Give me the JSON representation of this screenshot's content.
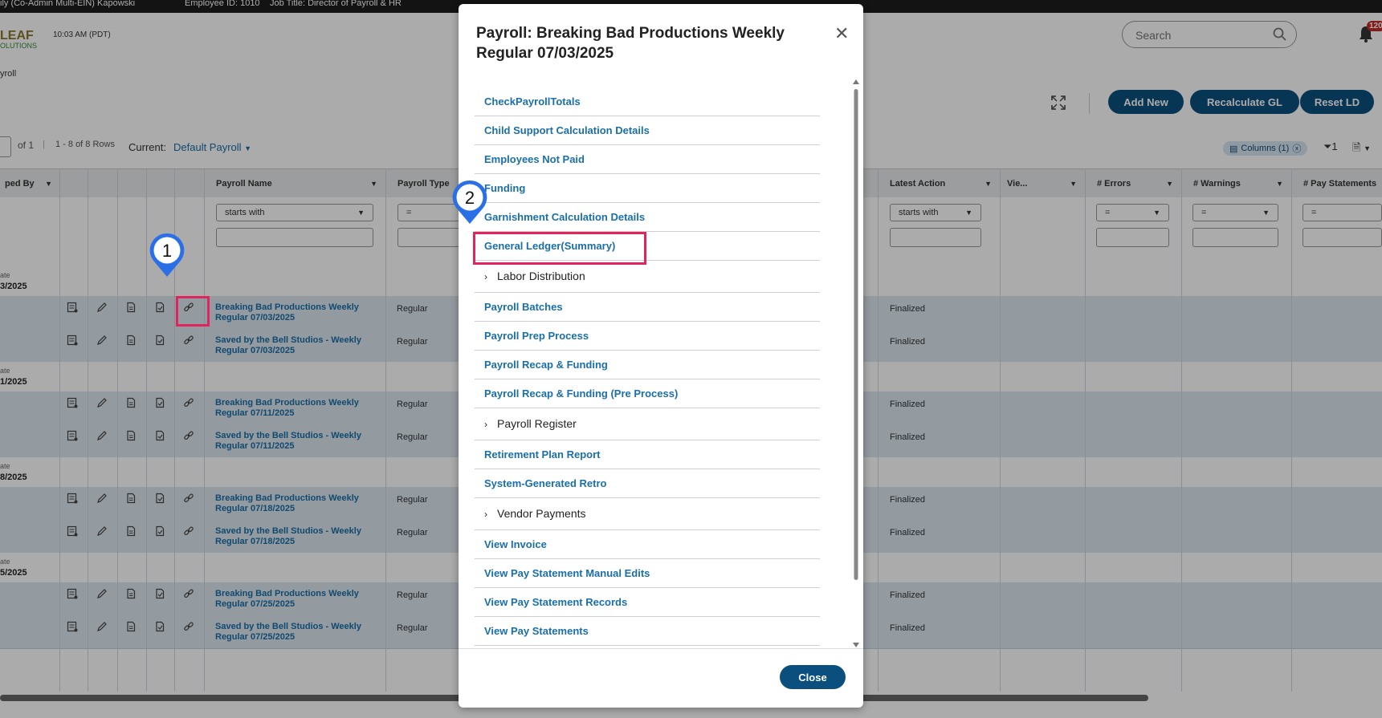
{
  "topbar": {
    "user": "ily (Co-Admin Multi-EIN) Kapowski",
    "employee_id": "Employee ID: 1010",
    "job_title": "Job Title: Director of Payroll & HR"
  },
  "header": {
    "logo_text": "LEAF",
    "logo_sub": "OLUTIONS",
    "time": "10:03 AM (PDT)",
    "search_placeholder": "Search",
    "notification_count": "120"
  },
  "breadcrumb": "yroll",
  "toolbar": {
    "add_new": "Add New",
    "recalculate_gl": "Recalculate GL",
    "reset_ld": "Reset LD",
    "page_of": "of 1",
    "rows_info": "1 - 8 of 8 Rows",
    "current_label": "Current:",
    "current_value": "Default Payroll",
    "columns_label": "Columns (1)",
    "filter_count": "1"
  },
  "grid": {
    "headers": {
      "sped_by": "ped By",
      "payroll_name": "Payroll Name",
      "payroll_type": "Payroll Type",
      "latest_action": "Latest Action",
      "view": "Vie...",
      "errors": "# Errors",
      "warnings": "# Warnings",
      "pay_statements": "# Pay Statements"
    },
    "filters": {
      "name_op": "starts with",
      "type_op": "=",
      "action_op": "starts with",
      "errors_op": "=",
      "warnings_op": "=",
      "pay_op": "="
    },
    "group_label": "ate",
    "groups": [
      {
        "date": "3/2025"
      },
      {
        "date": "1/2025"
      },
      {
        "date": "8/2025"
      },
      {
        "date": "5/2025"
      }
    ],
    "rows": [
      {
        "name": "Breaking Bad Productions Weekly Regular 07/03/2025",
        "type": "Regular",
        "action": "Finalized"
      },
      {
        "name": "Saved by the Bell Studios - Weekly Regular 07/03/2025",
        "type": "Regular",
        "action": "Finalized"
      },
      {
        "name": "Breaking Bad Productions Weekly Regular 07/11/2025",
        "type": "Regular",
        "action": "Finalized"
      },
      {
        "name": "Saved by the Bell Studios - Weekly Regular 07/11/2025",
        "type": "Regular",
        "action": "Finalized"
      },
      {
        "name": "Breaking Bad Productions Weekly Regular 07/18/2025",
        "type": "Regular",
        "action": "Finalized"
      },
      {
        "name": "Saved by the Bell Studios - Weekly Regular 07/18/2025",
        "type": "Regular",
        "action": "Finalized"
      },
      {
        "name": "Breaking Bad Productions Weekly Regular 07/25/2025",
        "type": "Regular",
        "action": "Finalized"
      },
      {
        "name": "Saved by the Bell Studios - Weekly Regular 07/25/2025",
        "type": "Regular",
        "action": "Finalized"
      }
    ]
  },
  "modal": {
    "title": "Payroll: Breaking Bad Productions Weekly Regular 07/03/2025",
    "close_label": "Close",
    "items": [
      {
        "label": "CheckPayrollTotals",
        "group": false
      },
      {
        "label": "Child Support Calculation Details",
        "group": false
      },
      {
        "label": "Employees Not Paid",
        "group": false
      },
      {
        "label": "Funding",
        "group": false
      },
      {
        "label": "Garnishment Calculation Details",
        "group": false
      },
      {
        "label": "General Ledger(Summary)",
        "group": false
      },
      {
        "label": "Labor Distribution",
        "group": true
      },
      {
        "label": "Payroll Batches",
        "group": false
      },
      {
        "label": "Payroll Prep Process",
        "group": false
      },
      {
        "label": "Payroll Recap & Funding",
        "group": false
      },
      {
        "label": "Payroll Recap & Funding (Pre Process)",
        "group": false
      },
      {
        "label": "Payroll Register",
        "group": true
      },
      {
        "label": "Retirement Plan Report",
        "group": false
      },
      {
        "label": "System-Generated Retro",
        "group": false
      },
      {
        "label": "Vendor Payments",
        "group": true
      },
      {
        "label": "View Invoice",
        "group": false
      },
      {
        "label": "View Pay Statement Manual Edits",
        "group": false
      },
      {
        "label": "View Pay Statement Records",
        "group": false
      },
      {
        "label": "View Pay Statements",
        "group": false
      }
    ]
  },
  "callouts": {
    "step1": "1",
    "step2": "2"
  },
  "colors": {
    "accent": "#0b4f7e",
    "link": "#1a6fa8",
    "highlight": "#e0245e",
    "pin": "#2b6fe6"
  }
}
